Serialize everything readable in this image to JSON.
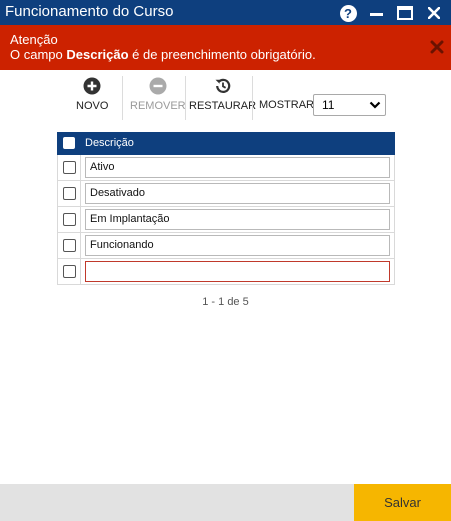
{
  "window": {
    "title": "Funcionamento do Curso",
    "help_glyph": "?"
  },
  "alert": {
    "title": "Atenção",
    "message_prefix": "O campo ",
    "message_field": "Descrição",
    "message_suffix": " é de preenchimento obrigatório.",
    "color": "#cc2200"
  },
  "toolbar": {
    "novo_label": "NOVO",
    "remover_label": "REMOVER",
    "restaurar_label": "RESTAURAR",
    "mostrar_label": "MOSTRAR:",
    "mostrar_value": "11"
  },
  "table": {
    "header": "Descrição",
    "rows": [
      {
        "descricao": "Ativo"
      },
      {
        "descricao": "Desativado"
      },
      {
        "descricao": "Em Implantação"
      },
      {
        "descricao": "Funcionando"
      },
      {
        "descricao": ""
      }
    ]
  },
  "pagination": {
    "text": "1 - 1 de 5"
  },
  "footer": {
    "save_label": "Salvar",
    "save_color": "#f6b600"
  },
  "colors": {
    "header_blue": "#0e3f7e",
    "alert_red": "#cc2200"
  },
  "icons": {
    "novo": "plus-circle-icon",
    "remover": "minus-circle-icon",
    "restaurar": "history-icon",
    "help": "question-circle-icon",
    "close": "close-icon"
  }
}
